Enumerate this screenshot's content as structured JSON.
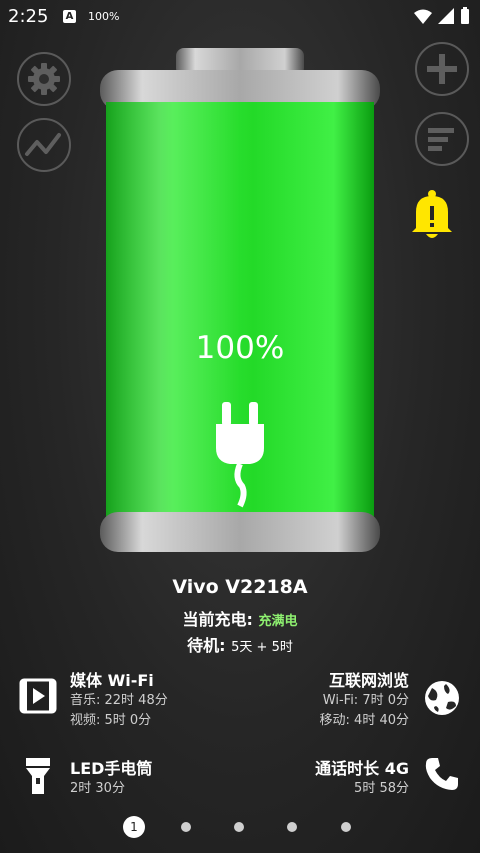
{
  "status_bar": {
    "time": "2:25",
    "app_badge": "A",
    "battery_text": "100%"
  },
  "battery": {
    "percent_label": "100%",
    "level": 1.0,
    "fill_color": "#19d81e"
  },
  "device": {
    "name": "Vivo V2218A",
    "charge_label": "当前充电: ",
    "charge_value": "充满电",
    "standby_label": "待机: ",
    "standby_value": "5天 + 5时"
  },
  "stats": {
    "media": {
      "title": "媒体 Wi-Fi",
      "line1": "音乐: 22时 48分",
      "line2": "视频: 5时 0分"
    },
    "internet": {
      "title": "互联网浏览",
      "line1": "Wi-Fi: 7时 0分",
      "line2": "移动: 4时 40分"
    },
    "led": {
      "title": "LED手电筒",
      "line1": "2时 30分"
    },
    "call": {
      "title": "通话时长 4G",
      "line1": "5时 58分"
    }
  },
  "pager": {
    "current": "1",
    "total": 5
  },
  "colors": {
    "accent_yellow": "#ffe600",
    "battery_green": "#19d81e",
    "text_green": "#8ef070"
  },
  "icons": [
    "gear-icon",
    "chart-icon",
    "plus-icon",
    "list-icon",
    "alarm-bell-icon",
    "plug-icon",
    "media-icon",
    "globe-icon",
    "flashlight-icon",
    "phone-icon"
  ]
}
